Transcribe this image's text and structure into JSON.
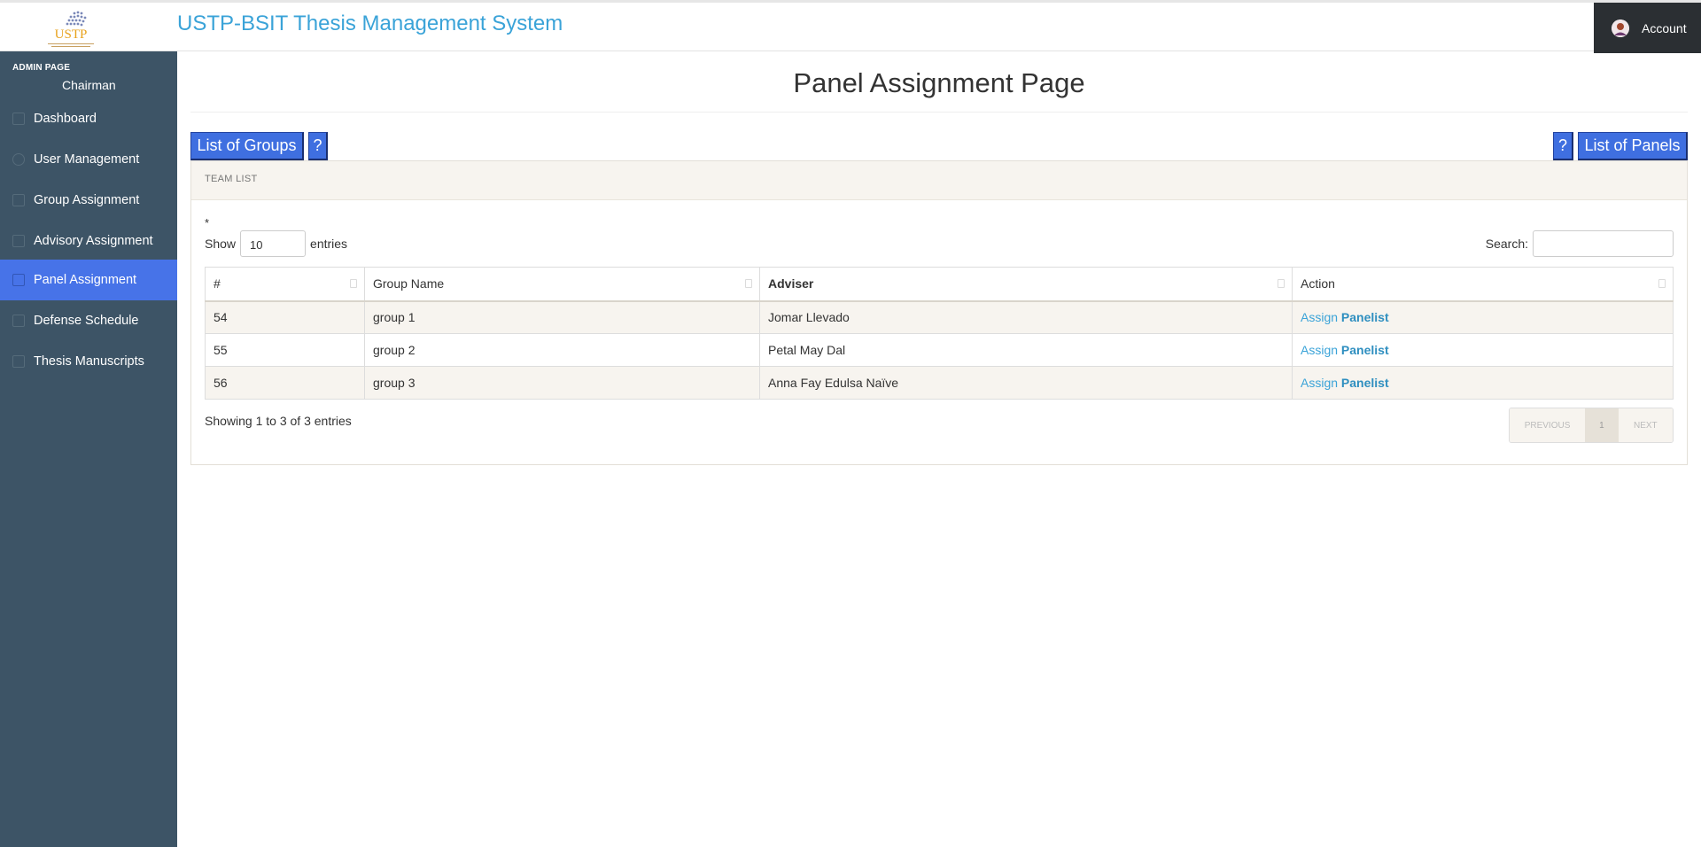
{
  "header": {
    "logo_text": "USTP",
    "title": "USTP-BSIT Thesis Management System",
    "account_label": "Account"
  },
  "sidebar": {
    "admin_label": "ADMIN PAGE",
    "role": "Chairman",
    "items": [
      {
        "label": "Dashboard",
        "icon": "chart-icon"
      },
      {
        "label": "User Management",
        "icon": "user-circle-icon"
      },
      {
        "label": "Group Assignment",
        "icon": "chart-icon"
      },
      {
        "label": "Advisory Assignment",
        "icon": "chart-icon"
      },
      {
        "label": "Panel Assignment",
        "icon": "chart-icon",
        "active": true
      },
      {
        "label": "Defense Schedule",
        "icon": "chart-icon"
      },
      {
        "label": "Thesis Manuscripts",
        "icon": "chart-icon"
      }
    ],
    "active_color": "#4773e8",
    "background_color": "#3d5466"
  },
  "main": {
    "page_title": "Panel Assignment Page",
    "list_groups_button": "List of Groups",
    "help_left": "?",
    "help_right": "?",
    "list_panels_button": "List of Panels",
    "panel_heading": "TEAM LIST",
    "asterisk": "*",
    "show_label": "Show",
    "entries_value": "10",
    "entries_label": "entries",
    "search_label": "Search:",
    "table": {
      "headers": [
        "#",
        "Group Name",
        "Adviser",
        "Action"
      ],
      "rows": [
        {
          "num": "54",
          "group": "group 1",
          "adviser": "Jomar Llevado",
          "action_verb": "Assign",
          "action_obj": "Panelist"
        },
        {
          "num": "55",
          "group": "group 2",
          "adviser": "Petal May Dal",
          "action_verb": "Assign",
          "action_obj": "Panelist"
        },
        {
          "num": "56",
          "group": "group 3",
          "adviser": "Anna Fay Edulsa Naïve",
          "action_verb": "Assign",
          "action_obj": "Panelist"
        }
      ]
    },
    "info": "Showing 1 to 3 of 3 entries",
    "pager": {
      "previous": "PREVIOUS",
      "current": "1",
      "next": "NEXT"
    },
    "button_color": "#3f6fe0",
    "link_color": "#3aa3d8"
  }
}
